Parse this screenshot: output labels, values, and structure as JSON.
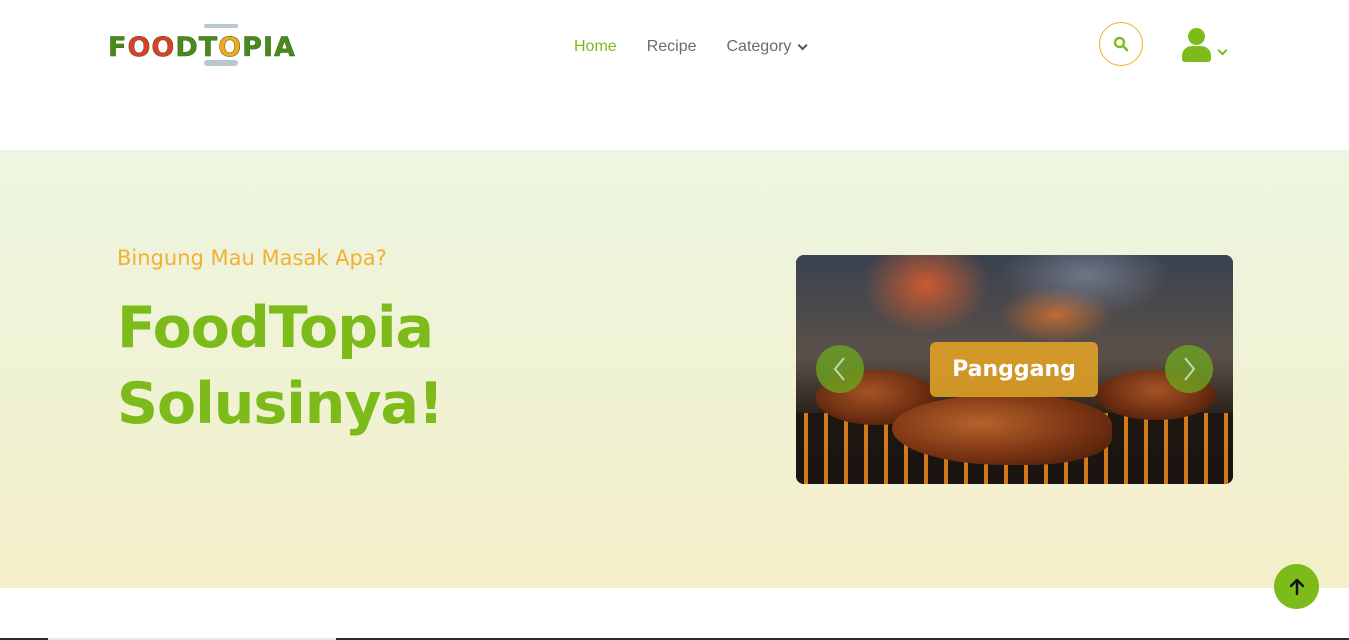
{
  "brand": {
    "logo_text_1": "F",
    "logo_text_2": "OO",
    "logo_text_3": "DT",
    "logo_text_4": "O",
    "logo_text_5": "PIA",
    "logo_alt": "FOODTOPIA"
  },
  "nav": {
    "home": "Home",
    "recipe": "Recipe",
    "category": "Category"
  },
  "header": {
    "search_icon": "search-icon",
    "user_icon": "user-icon"
  },
  "hero": {
    "subtitle": "Bingung Mau Masak Apa?",
    "title_line1": "FoodTopia",
    "title_line2": "Solusinya!"
  },
  "carousel": {
    "slide_label": "Panggang",
    "prev_icon": "chevron-left-icon",
    "next_icon": "chevron-right-icon"
  },
  "colors": {
    "brand_green": "#7dbb1a",
    "accent_orange": "#f2b033",
    "search_border": "#f2b01e"
  }
}
